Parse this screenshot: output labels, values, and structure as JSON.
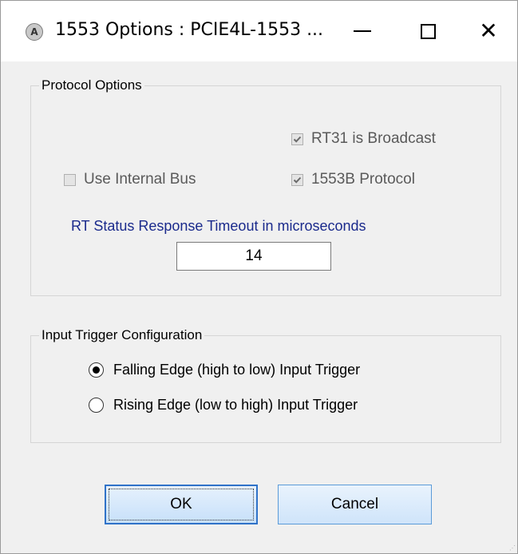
{
  "window": {
    "title": "1553 Options : PCIE4L-1553 ...",
    "app_icon_glyph": "A",
    "minimize_glyph": "minimize-icon",
    "maximize_glyph": "maximize-icon",
    "close_glyph": "✕"
  },
  "protocol_group": {
    "legend": "Protocol Options",
    "rt31_broadcast": {
      "label": "RT31 is Broadcast",
      "checked": true,
      "enabled": false
    },
    "use_internal_bus": {
      "label": "Use Internal Bus",
      "checked": false,
      "enabled": false
    },
    "protocol_1553b": {
      "label": "1553B Protocol",
      "checked": true,
      "enabled": false
    },
    "timeout_label": "RT Status Response Timeout in microseconds",
    "timeout_value": "14"
  },
  "trigger_group": {
    "legend": "Input Trigger Configuration",
    "options": [
      {
        "label": "Falling Edge (high to low) Input Trigger",
        "selected": true
      },
      {
        "label": "Rising Edge (low to high) Input Trigger",
        "selected": false
      }
    ]
  },
  "buttons": {
    "ok_label": "OK",
    "cancel_label": "Cancel"
  },
  "colors": {
    "label_blue": "#1a2a8c",
    "button_border": "#2f72c8",
    "window_bg": "#f0f0f0"
  }
}
